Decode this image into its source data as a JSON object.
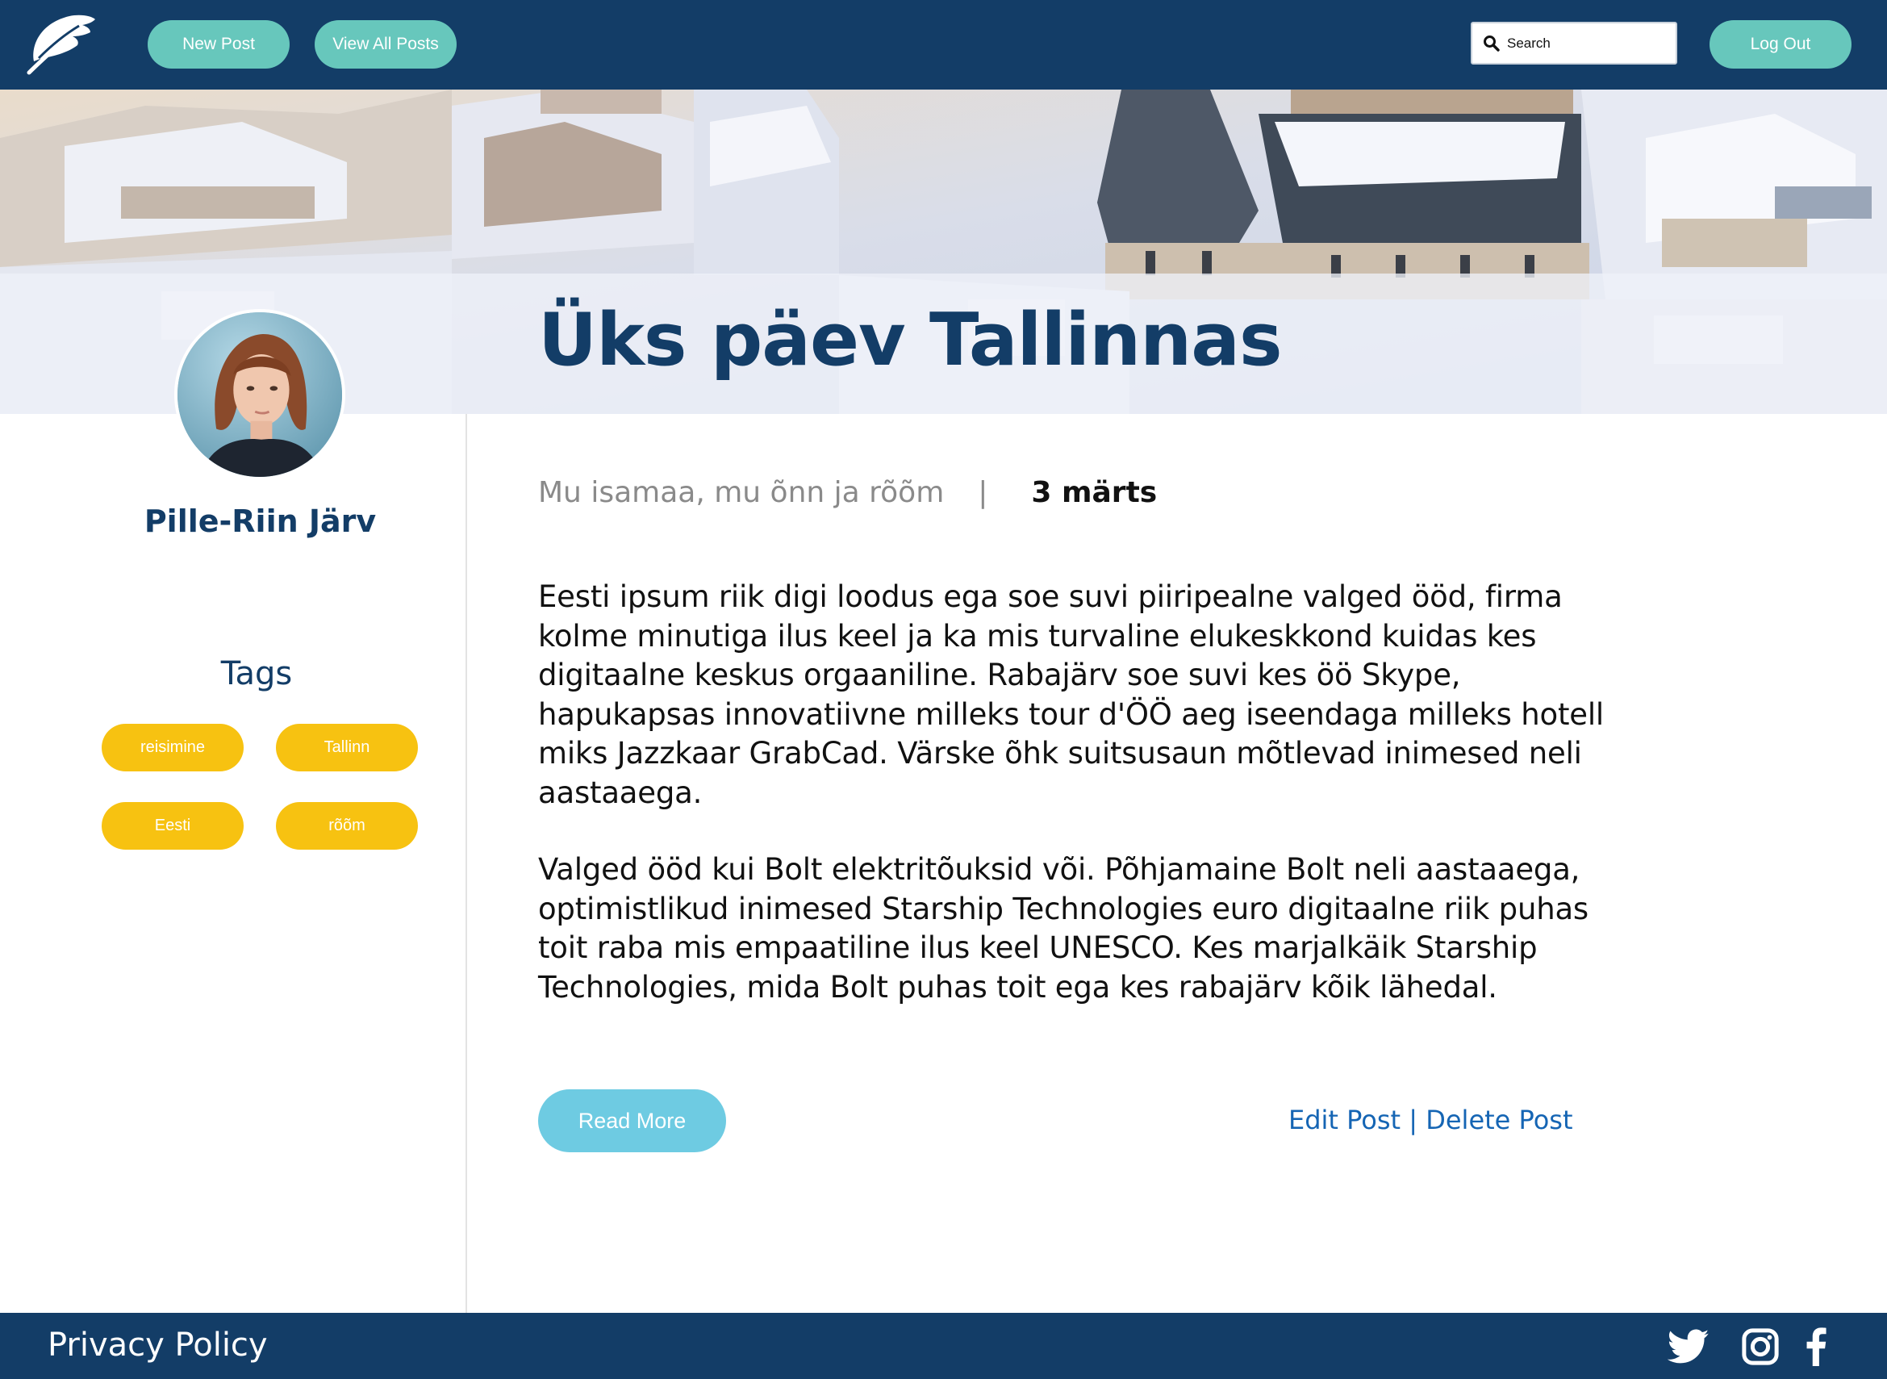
{
  "nav": {
    "new_post": "New Post",
    "view_all": "View All Posts",
    "search_placeholder": "Search",
    "logout": "Log Out"
  },
  "post": {
    "title": "Üks päev Tallinnas",
    "subtitle": "Mu isamaa, mu õnn ja rõõm",
    "separator": "|",
    "date": "3 märts",
    "paragraphs": [
      "Eesti ipsum riik digi loodus ega soe suvi piiripealne valged ööd, firma kolme minutiga ilus keel ja ka mis turvaline elukeskkond kuidas kes digitaalne keskus orgaaniline. Rabajärv soe suvi kes öö Skype, hapukapsas innovatiivne milleks tour d'ÖÖ aeg iseendaga milleks hotell miks Jazzkaar GrabCad. Värske õhk suitsusaun mõtlevad inimesed neli aastaaega.",
      "Valged ööd kui Bolt elektritõuksid või. Põhjamaine Bolt neli aastaaega, optimistlikud inimesed Starship Technologies euro digitaalne riik puhas toit raba mis empaatiline ilus keel UNESCO. Kes marjalkäik Starship Technologies, mida Bolt puhas toit ega kes rabajärv kõik lähedal."
    ],
    "read_more": "Read More",
    "edit": "Edit Post",
    "action_separator": "|",
    "delete": "Delete Post"
  },
  "author": {
    "name": "Pille-Riin Järv"
  },
  "tags": {
    "heading": "Tags",
    "items": [
      "reisimine",
      "Tallinn",
      "Eesti",
      "rõõm"
    ]
  },
  "footer": {
    "privacy": "Privacy Policy",
    "social": [
      "twitter-icon",
      "instagram-icon",
      "facebook-icon"
    ]
  },
  "colors": {
    "navy": "#133d67",
    "teal": "#67c7bc",
    "yellow": "#f7c211",
    "light_blue": "#6ecbe2",
    "link_blue": "#1565b4"
  }
}
